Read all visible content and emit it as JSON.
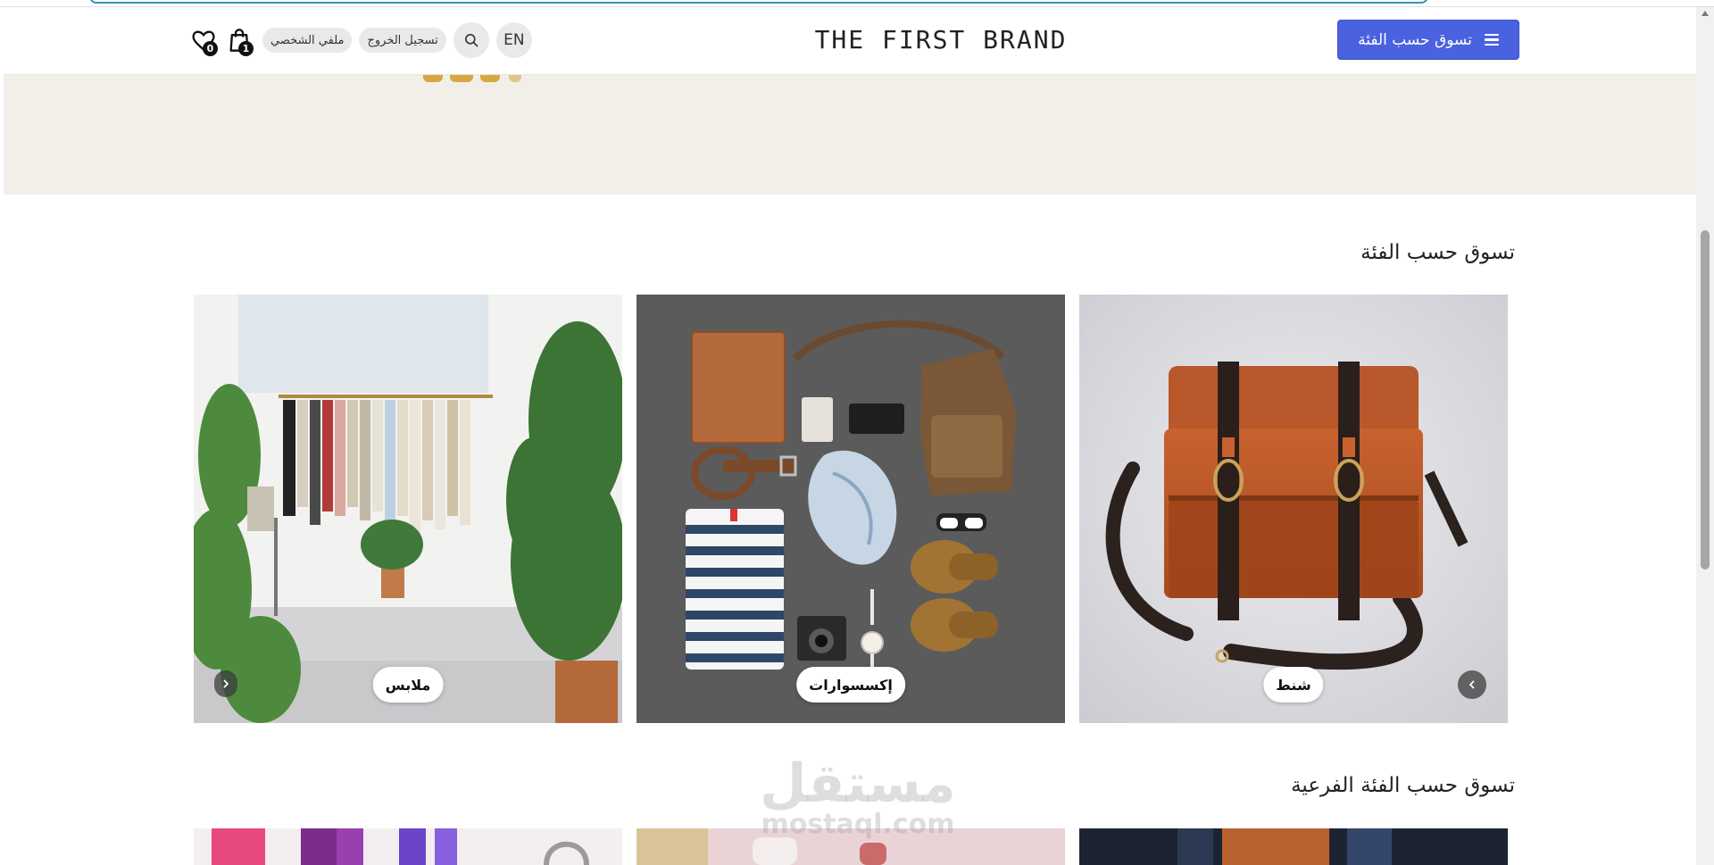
{
  "header": {
    "category_button_label": "تسوق حسب الفئة",
    "brand_name": "THE FIRST BRAND",
    "language_label": "EN",
    "logout_label": "تسجيل الخروج",
    "profile_label": "ملفي الشخصي",
    "cart_count": "1",
    "wishlist_count": "0"
  },
  "sections": {
    "categories_title": "تسوق حسب الفئة",
    "subcategories_title": "تسوق حسب الفئة الفرعية"
  },
  "categories": [
    {
      "label": "شنط",
      "image": "leather-backpack"
    },
    {
      "label": "إكسسوارات",
      "image": "accessories-flatlay"
    },
    {
      "label": "ملابس",
      "image": "clothing-rack-store"
    }
  ],
  "watermark": {
    "arabic": "مستقل",
    "latin": "mostaql.com"
  },
  "colors": {
    "accent": "#4a62e0",
    "hero_background": "#f2efe8",
    "badge": "#111111"
  }
}
